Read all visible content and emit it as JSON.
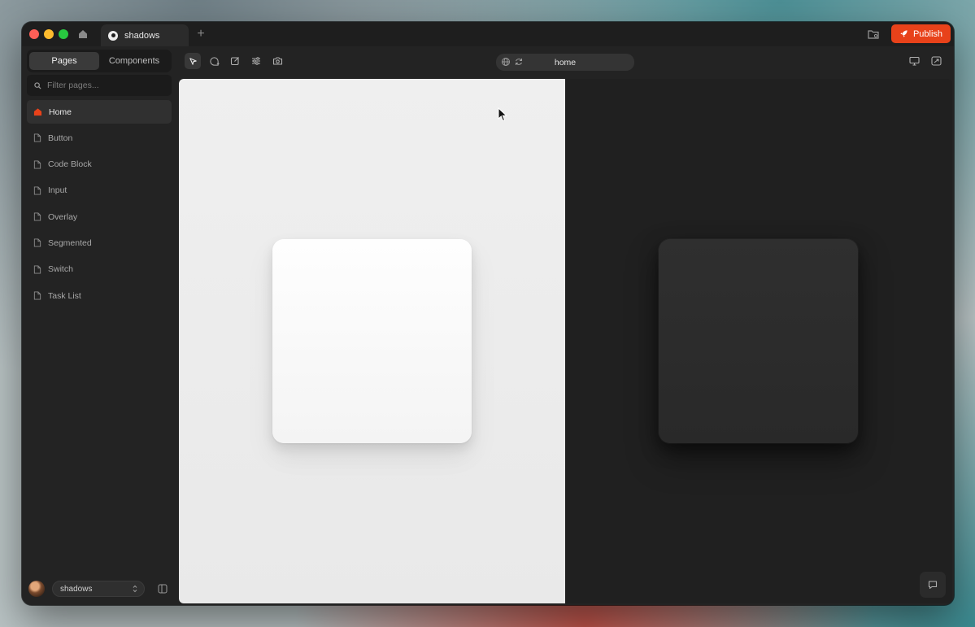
{
  "window": {
    "tab_title": "shadows",
    "new_tab_label": "+",
    "publish_label": "Publish",
    "accent": "#e8421a"
  },
  "sidebar": {
    "tabs": [
      {
        "label": "Pages",
        "active": true
      },
      {
        "label": "Components",
        "active": false
      }
    ],
    "filter_placeholder": "Filter pages...",
    "pages": [
      {
        "label": "Home",
        "icon": "home-icon",
        "active": true
      },
      {
        "label": "Button",
        "icon": "page-icon"
      },
      {
        "label": "Code Block",
        "icon": "page-icon"
      },
      {
        "label": "Input",
        "icon": "page-icon"
      },
      {
        "label": "Overlay",
        "icon": "page-icon"
      },
      {
        "label": "Segmented",
        "icon": "page-icon"
      },
      {
        "label": "Switch",
        "icon": "page-icon"
      },
      {
        "label": "Task List",
        "icon": "page-icon"
      }
    ],
    "project_name": "shadows"
  },
  "toolbar": {
    "url": "home",
    "tools": [
      "select-tool-icon",
      "comment-add-icon",
      "edit-icon",
      "sliders-icon",
      "camera-icon"
    ]
  }
}
